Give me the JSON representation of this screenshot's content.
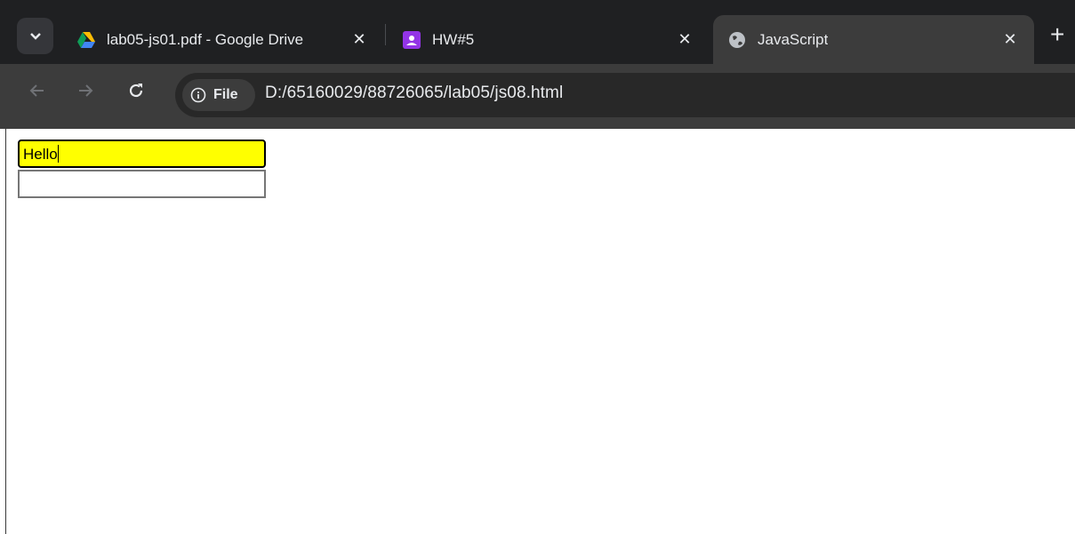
{
  "tabs": [
    {
      "title": "lab05-js01.pdf - Google Drive",
      "icon": "google-drive-icon",
      "active": false
    },
    {
      "title": "HW#5",
      "icon": "classroom-icon",
      "active": false
    },
    {
      "title": "JavaScript",
      "icon": "globe-icon",
      "active": true
    }
  ],
  "addressbar": {
    "scheme_label": "File",
    "url": "D:/65160029/88726065/lab05/js08.html"
  },
  "page": {
    "field1_value": "Hello",
    "field2_value": ""
  },
  "colors": {
    "tabbar_bg": "#1f2022",
    "toolbar_bg": "#3c3c3c",
    "field_highlight": "#ffff00"
  }
}
